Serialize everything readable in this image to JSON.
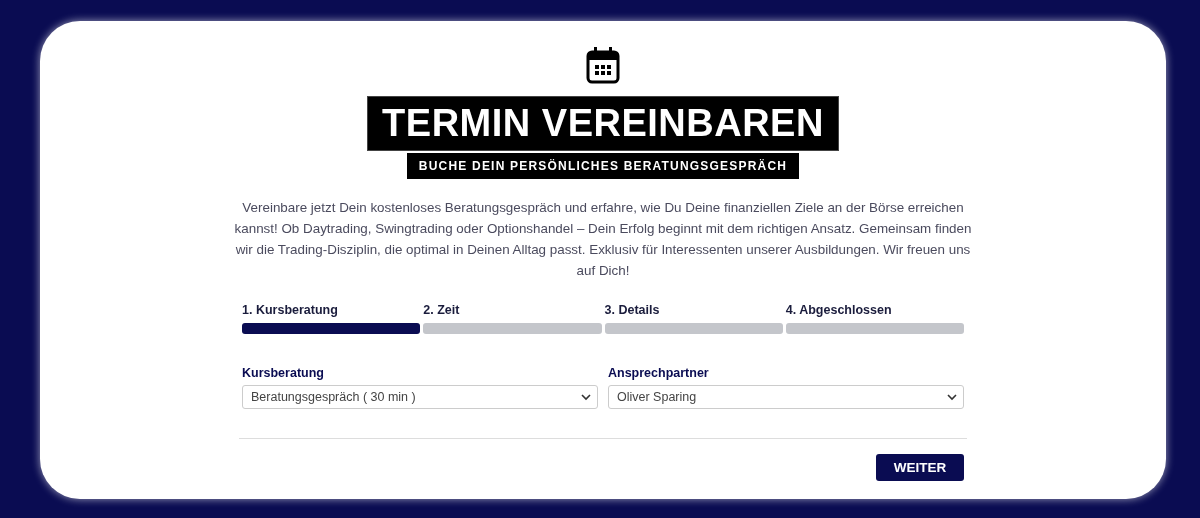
{
  "title": "TERMIN VEREINBAREN",
  "subtitle": "BUCHE DEIN PERSÖNLICHES BERATUNGSGESPRÄCH",
  "intro": "Vereinbare jetzt Dein kostenloses Beratungsgespräch und erfahre, wie Du Deine finanziellen Ziele an der Börse erreichen kannst! Ob Daytrading, Swingtrading oder Optionshandel – Dein Erfolg beginnt mit dem richtigen Ansatz. Gemeinsam finden wir die Trading-Disziplin, die optimal in Deinen Alltag passt. Exklusiv für Interessenten unserer Ausbildungen. Wir freuen uns auf Dich!",
  "steps": [
    {
      "label": "1. Kursberatung",
      "selected": true
    },
    {
      "label": "2. Zeit",
      "selected": false
    },
    {
      "label": "3. Details",
      "selected": false
    },
    {
      "label": "4. Abgeschlossen",
      "selected": false
    }
  ],
  "fields": [
    {
      "label": "Kursberatung",
      "value": "Beratungsgespräch ( 30 min )"
    },
    {
      "label": "Ansprechpartner",
      "value": "Oliver Sparing"
    }
  ],
  "button": "WEITER"
}
